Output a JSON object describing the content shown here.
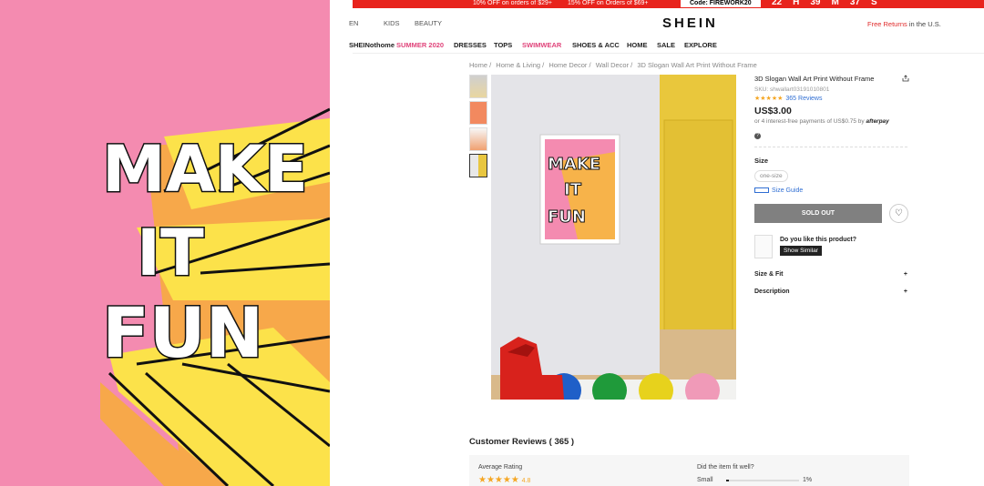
{
  "promo": {
    "offer1": "10% OFF on orders of $29+",
    "offer2": "15% OFF on Orders of $69+",
    "code": "Code: FIREWORK20",
    "countdown": [
      "22",
      "H",
      "39",
      "M",
      "37",
      "S"
    ]
  },
  "header": {
    "categories": [
      "EN",
      "KIDS",
      "BEAUTY"
    ],
    "logo": "SHEIN",
    "free_returns_red": "Free Returns",
    "free_returns_rest": " in the U.S."
  },
  "nav": [
    "SHEINothome",
    "SUMMER 2020",
    "DRESSES",
    "TOPS",
    "SWIMWEAR",
    "SHOES & ACC",
    "HOME",
    "SALE",
    "EXPLORE"
  ],
  "breadcrumbs": [
    "Home /",
    "Home & Living /",
    "Home Decor /",
    "Wall Decor /",
    "3D Slogan Wall Art Print Without Frame"
  ],
  "product": {
    "title": "3D Slogan Wall Art Print Without Frame",
    "sku": "SKU: shwallart03191010801",
    "stars": "★★★★★",
    "reviews_link": "365 Reviews",
    "price": "US$3.00",
    "installments": "or 4 interest-free payments of US$0.75 by",
    "afterpay": "afterpay",
    "help": "?",
    "size_label": "Size",
    "size_option": "one-size",
    "size_guide": "Size Guide",
    "sold_out": "SOLD OUT",
    "wish_icon": "♡",
    "like_question": "Do you like this product?",
    "show_similar": "Show Similar",
    "size_fit": "Size & Fit",
    "description": "Description",
    "plus": "+"
  },
  "art": {
    "line1": "MAKE",
    "line2": "IT",
    "line3": "FUN"
  },
  "reviews": {
    "heading": "Customer Reviews ( 365 )",
    "average_label": "Average Rating",
    "average_stars": "★★★★★",
    "average_value": "4.8",
    "fit_question": "Did the item fit well?",
    "fit_small_label": "Small",
    "fit_small_value": 0.01,
    "fit_small_pct": "1%"
  },
  "colors": {
    "accent_red": "#e8231c",
    "nav_pink": "#e0437a",
    "link_blue": "#2f6ed3",
    "star": "#f5a623",
    "art_pink": "#f48bb0"
  }
}
